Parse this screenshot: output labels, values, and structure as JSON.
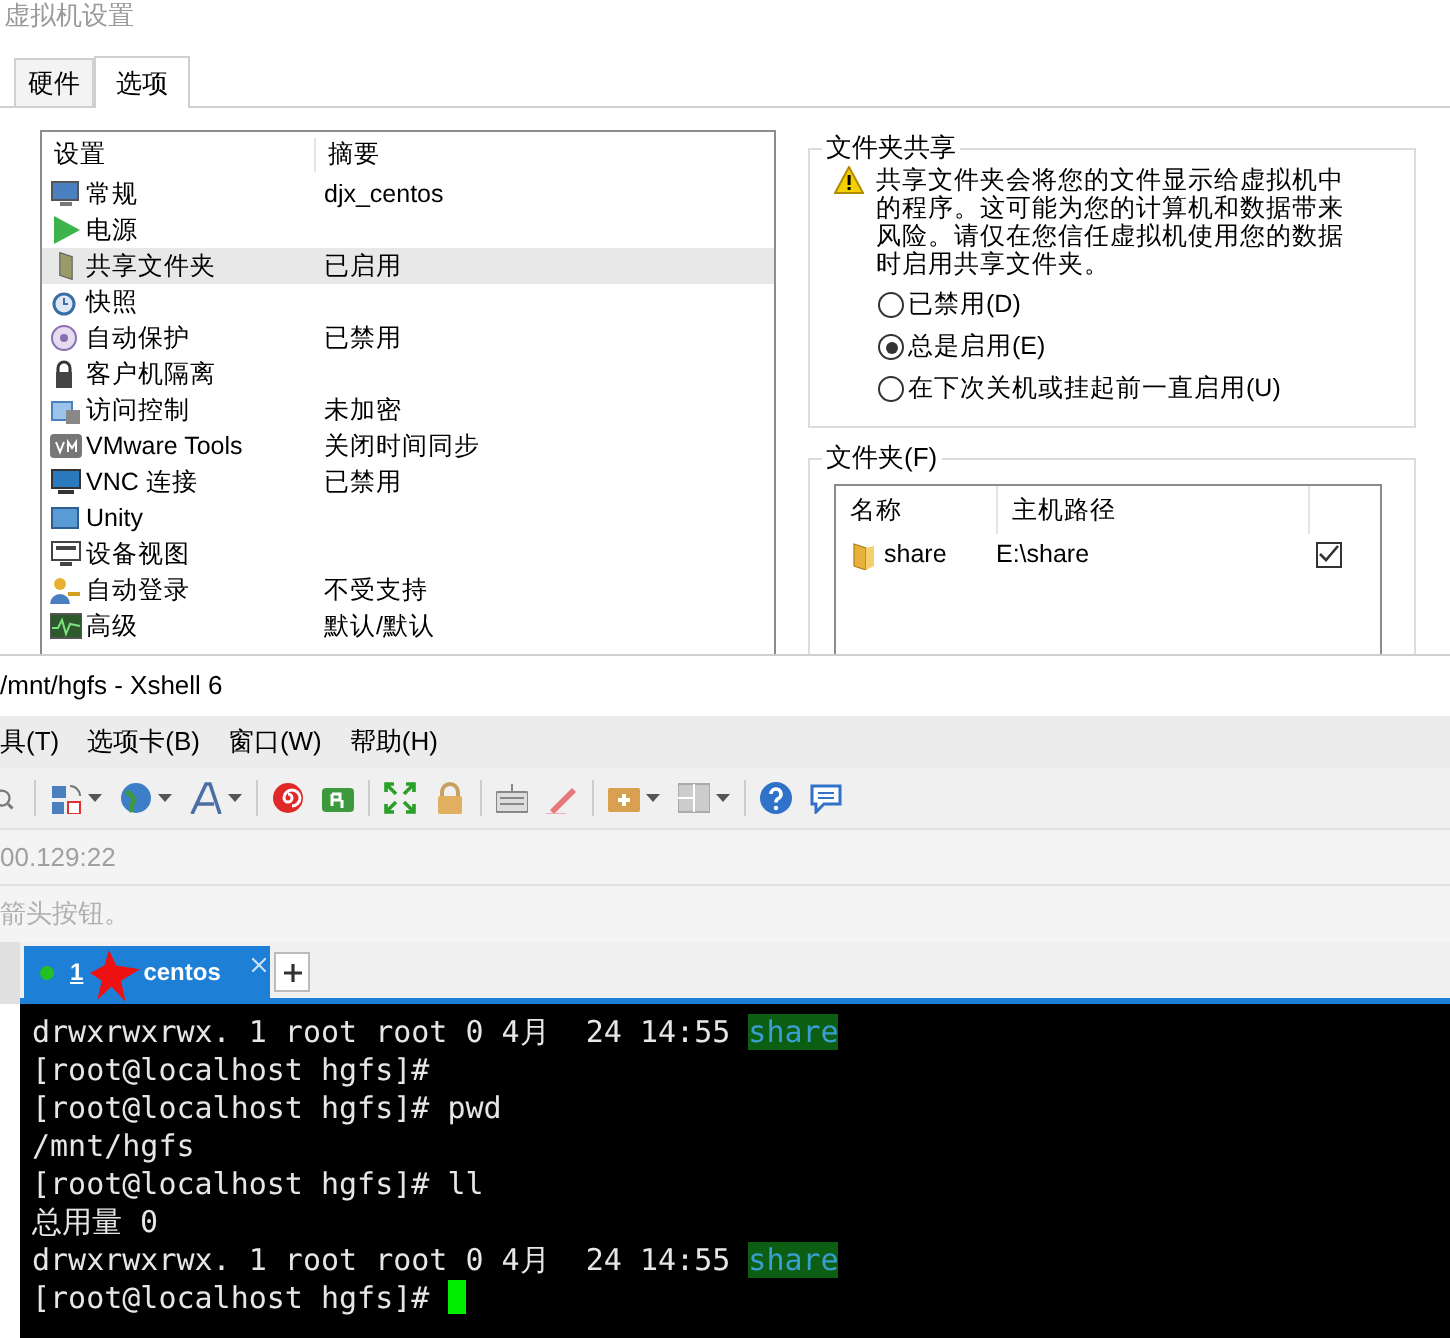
{
  "vm_window": {
    "title": "虚拟机设置",
    "tabs": [
      {
        "label": "硬件",
        "selected": false
      },
      {
        "label": "选项",
        "selected": true
      }
    ],
    "settings_list": {
      "columns": [
        "设置",
        "摘要"
      ],
      "rows": [
        {
          "name": "常规",
          "summary": "djx_centos",
          "selected": false
        },
        {
          "name": "电源",
          "summary": "",
          "selected": false
        },
        {
          "name": "共享文件夹",
          "summary": "已启用",
          "selected": true
        },
        {
          "name": "快照",
          "summary": "",
          "selected": false
        },
        {
          "name": "自动保护",
          "summary": "已禁用",
          "selected": false
        },
        {
          "name": "客户机隔离",
          "summary": "",
          "selected": false
        },
        {
          "name": "访问控制",
          "summary": "未加密",
          "selected": false
        },
        {
          "name": "VMware Tools",
          "summary": "关闭时间同步",
          "selected": false
        },
        {
          "name": "VNC 连接",
          "summary": "已禁用",
          "selected": false
        },
        {
          "name": "Unity",
          "summary": "",
          "selected": false
        },
        {
          "name": "设备视图",
          "summary": "",
          "selected": false
        },
        {
          "name": "自动登录",
          "summary": "不受支持",
          "selected": false
        },
        {
          "name": "高级",
          "summary": "默认/默认",
          "selected": false
        }
      ]
    },
    "folder_sharing": {
      "title": "文件夹共享",
      "warning": "共享文件夹会将您的文件显示给虚拟机中的程序。这可能为您的计算机和数据带来风险。请仅在您信任虚拟机使用您的数据时启用共享文件夹。",
      "options": [
        {
          "label": "已禁用(D)",
          "selected": false
        },
        {
          "label": "总是启用(E)",
          "selected": true
        },
        {
          "label": "在下次关机或挂起前一直启用(U)",
          "selected": false
        }
      ]
    },
    "folders": {
      "title": "文件夹(F)",
      "columns": [
        "名称",
        "主机路径"
      ],
      "rows": [
        {
          "name": "share",
          "path": "E:\\share",
          "checked": true
        }
      ]
    }
  },
  "xshell": {
    "title": "/mnt/hgfs - Xshell 6",
    "menu": [
      "具(T)",
      "选项卡(B)",
      "窗口(W)",
      "帮助(H)"
    ],
    "address": "00.129:22",
    "hint": "箭头按钮。",
    "tabs": [
      {
        "number": "1",
        "label": "centos",
        "connected": true,
        "selected": true
      }
    ],
    "terminal_lines": [
      {
        "segments": [
          {
            "kind": "plain",
            "text": "drwxrwxrwx. 1 root root 0 4月  24 14:55 "
          },
          {
            "kind": "dir",
            "text": "share"
          }
        ],
        "cursor": false
      },
      {
        "segments": [
          {
            "kind": "plain",
            "text": "[root@localhost hgfs]#"
          }
        ],
        "cursor": false
      },
      {
        "segments": [
          {
            "kind": "plain",
            "text": "[root@localhost hgfs]# pwd"
          }
        ],
        "cursor": false
      },
      {
        "segments": [
          {
            "kind": "plain",
            "text": "/mnt/hgfs"
          }
        ],
        "cursor": false
      },
      {
        "segments": [
          {
            "kind": "plain",
            "text": "[root@localhost hgfs]# ll"
          }
        ],
        "cursor": false
      },
      {
        "segments": [
          {
            "kind": "plain",
            "text": "总用量 0"
          }
        ],
        "cursor": false
      },
      {
        "segments": [
          {
            "kind": "plain",
            "text": "drwxrwxrwx. 1 root root 0 4月  24 14:55 "
          },
          {
            "kind": "dir",
            "text": "share"
          }
        ],
        "cursor": false
      },
      {
        "segments": [
          {
            "kind": "plain",
            "text": "[root@localhost hgfs]# "
          }
        ],
        "cursor": true
      }
    ]
  }
}
